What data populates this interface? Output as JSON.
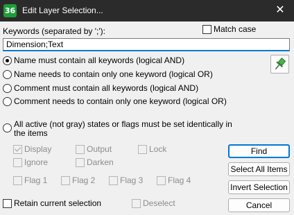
{
  "window": {
    "app_icon_text": "36",
    "title": "Edit Layer Selection...",
    "close_glyph": "✕"
  },
  "keywords": {
    "label": "Keywords (separated by ';'):",
    "value": "Dimension;Text",
    "match_case_label": "Match case",
    "match_case_checked": false
  },
  "radios": [
    {
      "label": "Name must contain all keywords (logical AND)",
      "checked": true
    },
    {
      "label": "Name needs to contain only one keyword (logical OR)",
      "checked": false
    },
    {
      "label": "Comment must contain all keywords (logical AND)",
      "checked": false
    },
    {
      "label": "Comment needs to contain only one keyword (logical OR)",
      "checked": false
    },
    {
      "label_line1": "All active (not gray) states or flags must be set identically in",
      "label_line2": "the items",
      "checked": false
    }
  ],
  "states": {
    "display": {
      "label": "Display",
      "checked": true
    },
    "output": {
      "label": "Output",
      "checked": false
    },
    "lock": {
      "label": "Lock",
      "checked": false
    },
    "ignore": {
      "label": "Ignore",
      "checked": false
    },
    "darken": {
      "label": "Darken",
      "checked": false
    },
    "flag1": {
      "label": "Flag 1"
    },
    "flag2": {
      "label": "Flag 2"
    },
    "flag3": {
      "label": "Flag 3"
    },
    "flag4": {
      "label": "Flag 4"
    }
  },
  "bottom": {
    "retain_label": "Retain current selection",
    "deselect_label": "Deselect"
  },
  "buttons": {
    "find": "Find",
    "select_all": "Select All Items",
    "invert": "Invert Selection",
    "cancel": "Cancel"
  },
  "icons": {
    "pin": "pin-icon"
  },
  "colors": {
    "titlebar": "#2b2b2b",
    "app_icon": "#1e9d3a",
    "accent": "#0078d7",
    "background": "#f0f0f0"
  }
}
